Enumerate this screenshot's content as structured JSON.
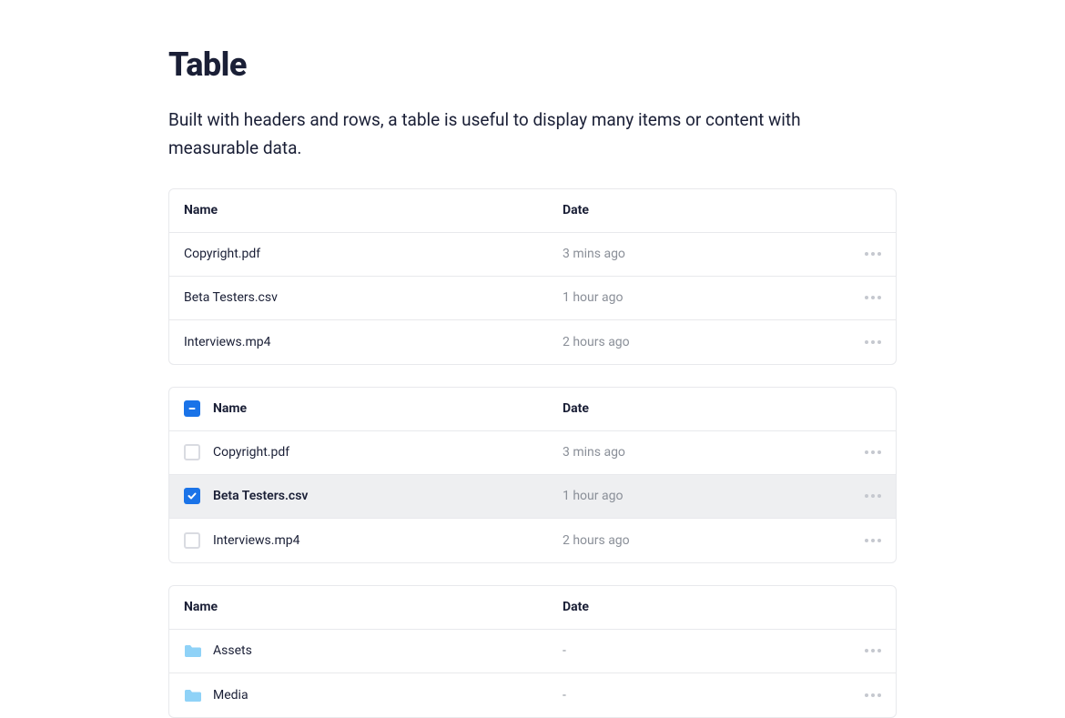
{
  "title": "Table",
  "description": "Built with headers and rows, a table is useful to display many items or content with measurable data.",
  "headers": {
    "name": "Name",
    "date": "Date"
  },
  "table1": {
    "rows": [
      {
        "name": "Copyright.pdf",
        "date": "3 mins ago"
      },
      {
        "name": "Beta Testers.csv",
        "date": "1 hour ago"
      },
      {
        "name": "Interviews.mp4",
        "date": "2 hours ago"
      }
    ]
  },
  "table2": {
    "select_all_state": "indeterminate",
    "rows": [
      {
        "name": "Copyright.pdf",
        "date": "3 mins ago",
        "checked": false
      },
      {
        "name": "Beta Testers.csv",
        "date": "1 hour ago",
        "checked": true
      },
      {
        "name": "Interviews.mp4",
        "date": "2 hours ago",
        "checked": false
      }
    ]
  },
  "table3": {
    "rows": [
      {
        "name": "Assets",
        "date": "-",
        "icon": "folder"
      },
      {
        "name": "Media",
        "date": "-",
        "icon": "folder"
      }
    ]
  }
}
